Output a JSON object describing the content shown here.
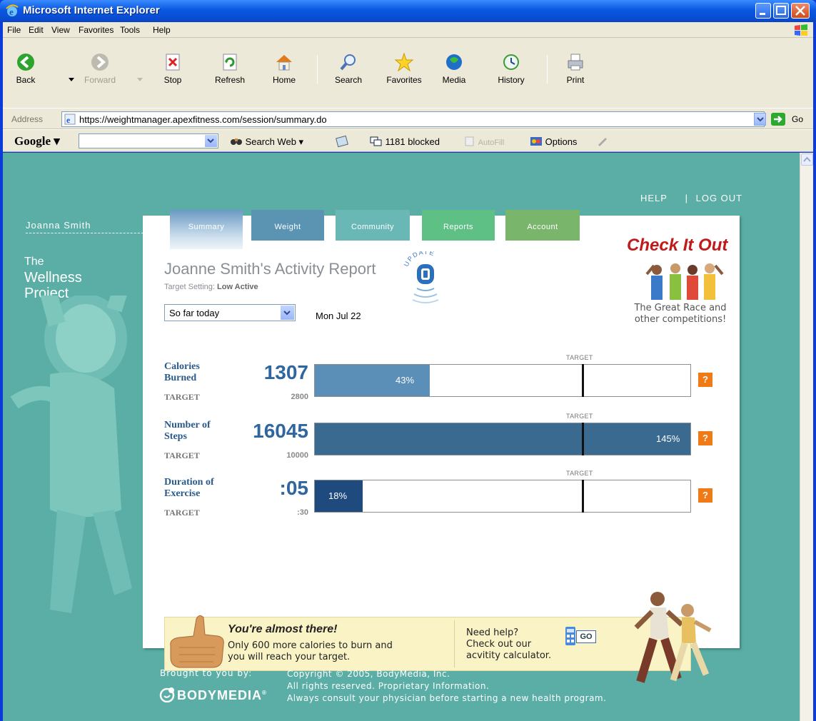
{
  "window": {
    "title": "Microsoft Internet Explorer"
  },
  "menu": [
    "File",
    "Edit",
    "View",
    "Favorites",
    "Tools",
    "Help"
  ],
  "toolbar": [
    {
      "label": "Back",
      "icon": "back-arrow-icon",
      "disabled": false
    },
    {
      "label": "Forward",
      "icon": "forward-arrow-icon",
      "disabled": true
    },
    {
      "label": "Stop",
      "icon": "stop-icon",
      "disabled": false
    },
    {
      "label": "Refresh",
      "icon": "refresh-icon",
      "disabled": false
    },
    {
      "label": "Home",
      "icon": "home-icon",
      "disabled": false
    },
    {
      "label": "Search",
      "icon": "search-icon",
      "disabled": false
    },
    {
      "label": "Favorites",
      "icon": "star-icon",
      "disabled": false
    },
    {
      "label": "Media",
      "icon": "media-icon",
      "disabled": false
    },
    {
      "label": "History",
      "icon": "history-icon",
      "disabled": false
    },
    {
      "label": "Print",
      "icon": "print-icon",
      "disabled": false
    }
  ],
  "address": {
    "label": "Address",
    "url": "https://weightmanager.apexfitness.com/session/summary.do",
    "go_label": "Go"
  },
  "google": {
    "logo": "Google",
    "search_web": "Search Web",
    "blocked": "1181 blocked",
    "autofill": "AutoFill",
    "options": "Options"
  },
  "page": {
    "help": "HELP",
    "separator": "|",
    "logout": "LOG OUT",
    "user": "Joanna Smith",
    "wellness_line1": "The",
    "wellness_line2": "Wellness",
    "wellness_line3": "Project",
    "tabs": [
      "Summary",
      "Weight",
      "Community",
      "Reports",
      "Account"
    ],
    "report_title": "Joanne Smith's Activity Report",
    "target_setting_label": "Target Setting:",
    "target_setting_value": "Low Active",
    "update_label": "UPDATE",
    "period": "So far today",
    "date": "Mon Jul 22",
    "checkit_title": "Check It Out",
    "checkit_caption_1": "The Great Race and",
    "checkit_caption_2": "other competitions!",
    "target_caption": "TARGET",
    "target_label": "TARGET",
    "metrics": [
      {
        "label_1": "Calories",
        "label_2": "Burned",
        "value": "1307",
        "target": "2800",
        "pct_label": "43%",
        "fraction": 0.43,
        "color": "#5b8fb8"
      },
      {
        "label_1": "Number of",
        "label_2": "Steps",
        "value": "16045",
        "target": "10000",
        "pct_label": "145%",
        "fraction": 1.45,
        "color": "#3a6a90"
      },
      {
        "label_1": "Duration of",
        "label_2": "Exercise",
        "value": ":05",
        "target": ":30",
        "pct_label": "18%",
        "fraction": 0.18,
        "color": "#1f4a7e"
      }
    ],
    "help_q": "?",
    "banner": {
      "headline": "You're almost there!",
      "body_1": "Only 600 more calories to burn and",
      "body_2": "you will reach your target.",
      "help_1": "Need help?",
      "help_2": "Check out our",
      "help_3": "acvitity calculator.",
      "go": "GO"
    },
    "footer": {
      "brought": "Brought to you by:",
      "brand": "BODYMEDIA",
      "copy_1": "Copyright © 2005, BodyMedia, Inc.",
      "copy_2": "All rights reserved. Proprietary Information.",
      "copy_3": "Always consult your physician before starting a new health program."
    }
  }
}
